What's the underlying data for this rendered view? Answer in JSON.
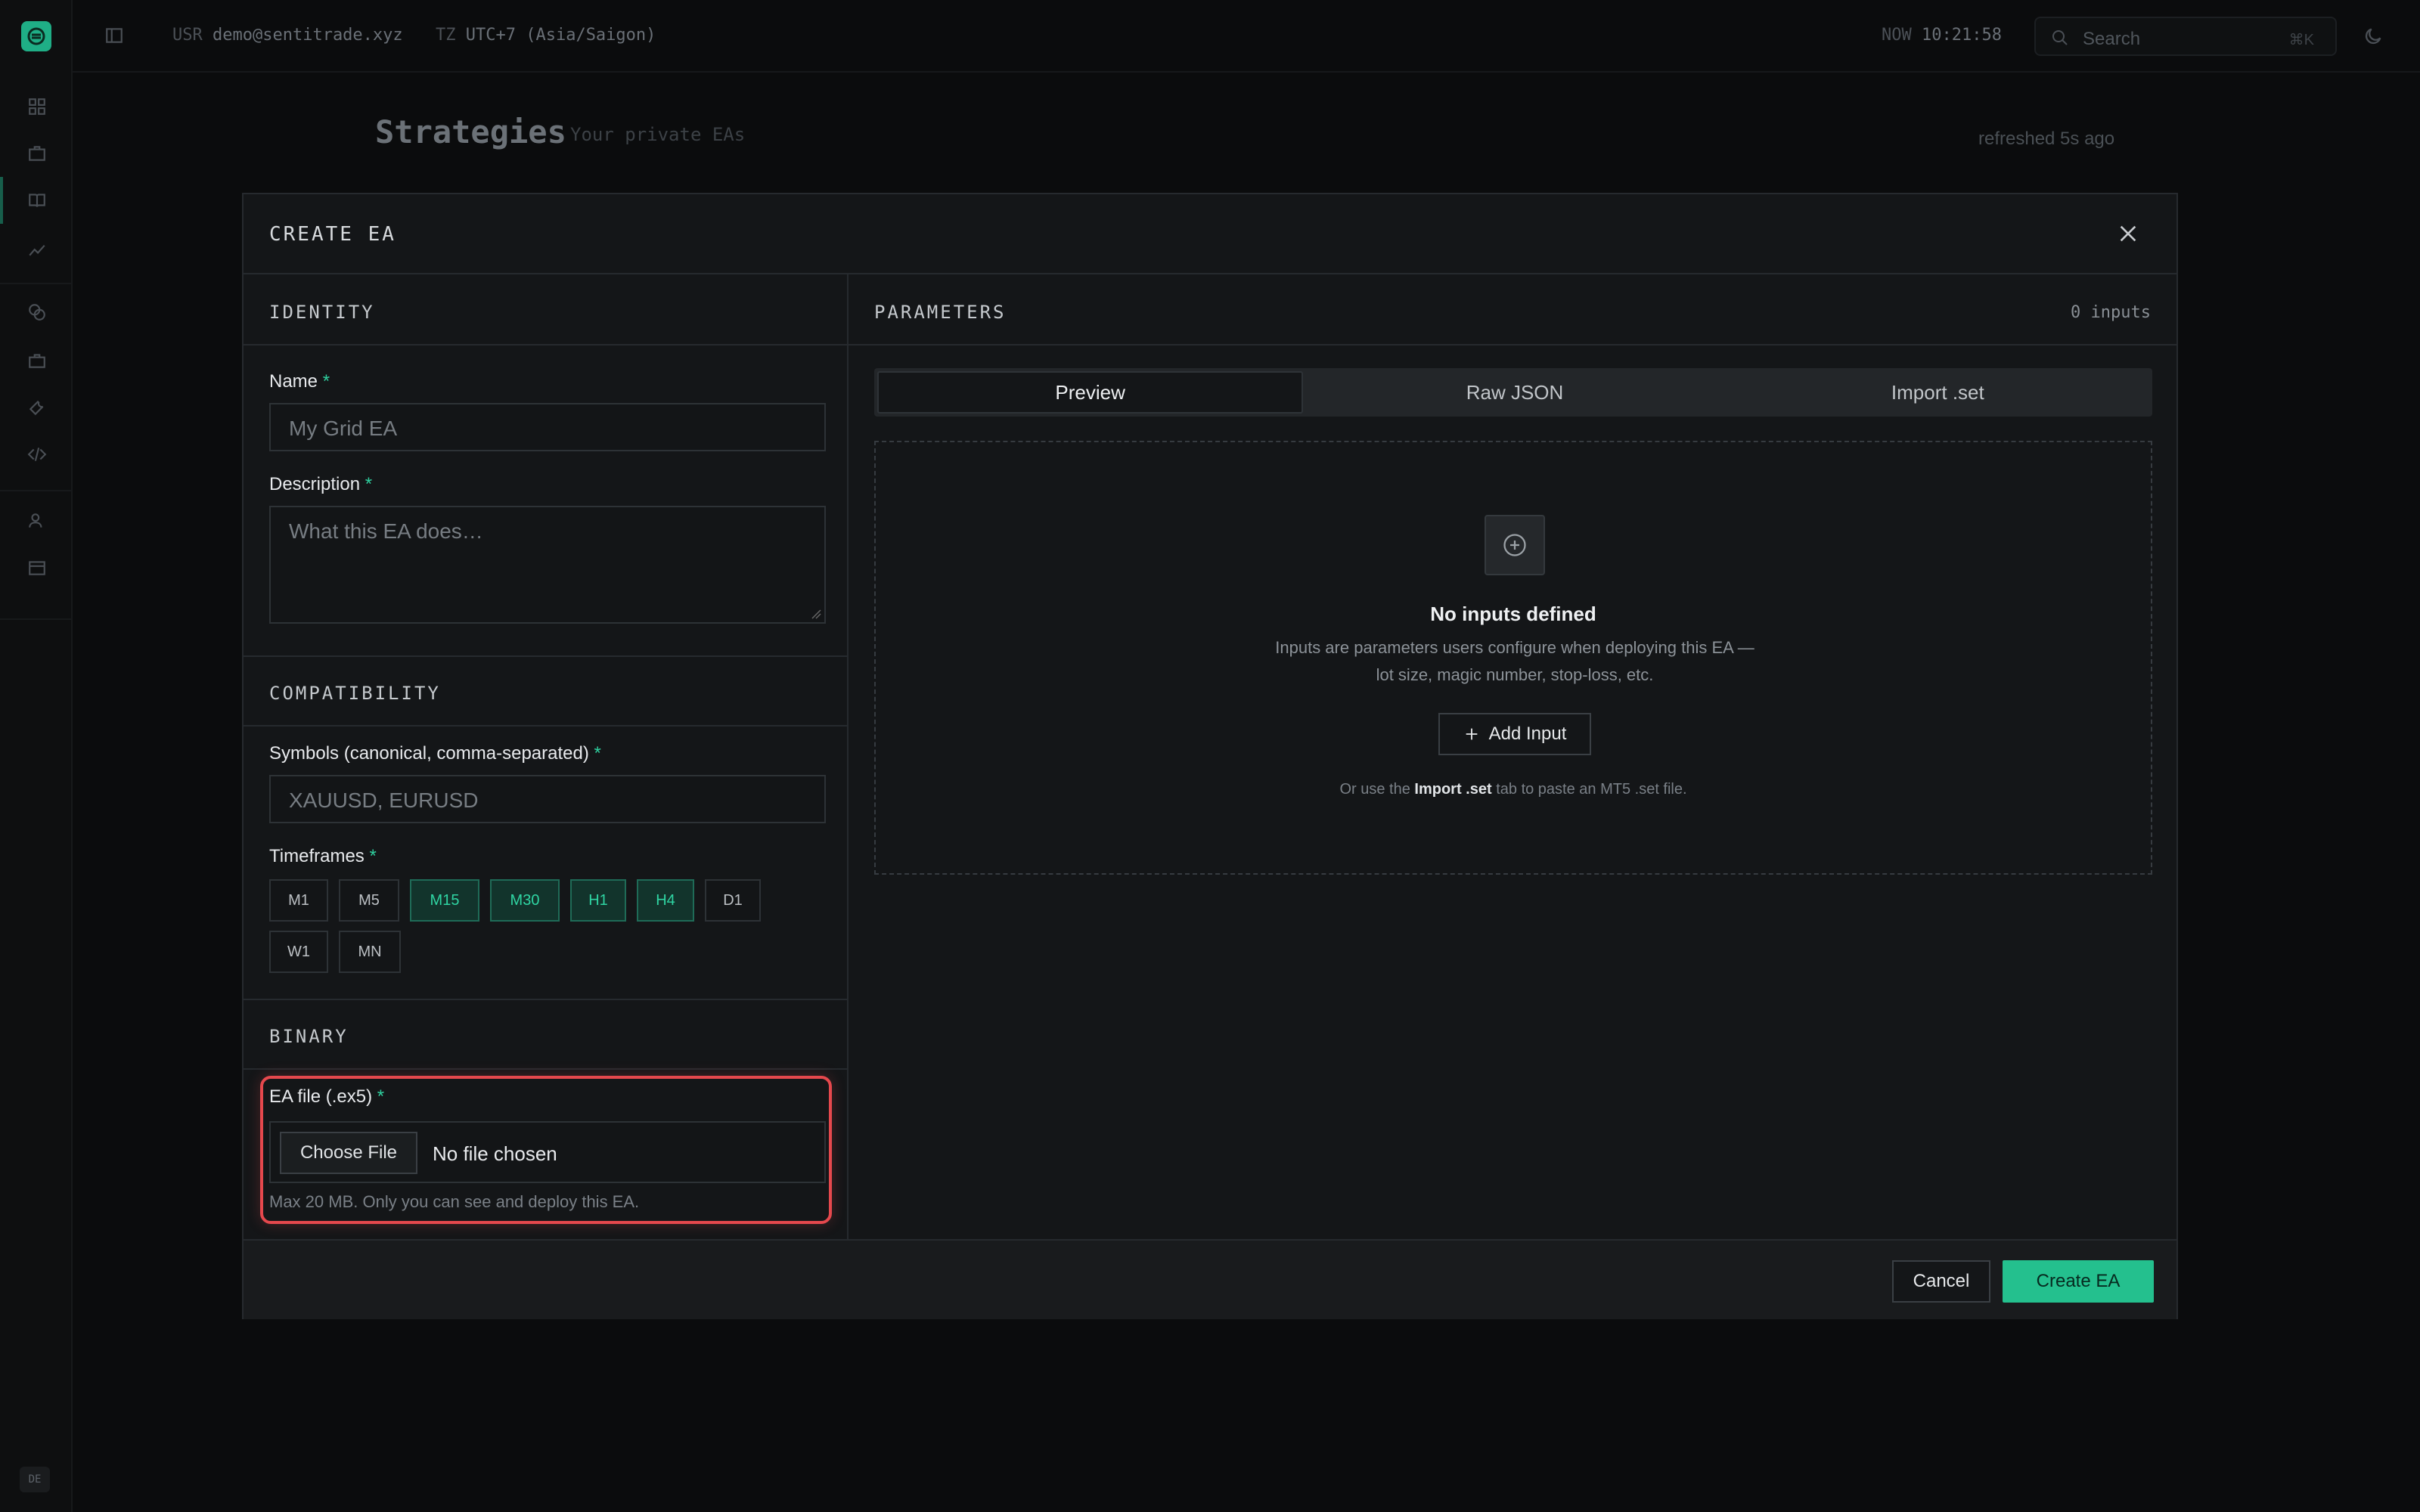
{
  "topbar": {
    "usr_label": "USR",
    "usr_value": "demo@sentitrade.xyz",
    "tz_label": "TZ",
    "tz_value": "UTC+7 (Asia/Saigon)",
    "now_label": "NOW",
    "now_value": "10:21:58",
    "search_label": "Search",
    "search_shortcut": "⌘K"
  },
  "page": {
    "title": "Strategies",
    "subtitle": "Your private EAs",
    "refreshed": "refreshed 5s ago"
  },
  "sidebar": {
    "footer_badge": "DE"
  },
  "modal": {
    "title": "CREATE EA",
    "identity": {
      "heading": "IDENTITY",
      "name_label": "Name",
      "name_placeholder": "My Grid EA",
      "description_label": "Description",
      "description_placeholder": "What this EA does…"
    },
    "compatibility": {
      "heading": "COMPATIBILITY",
      "symbols_label": "Symbols (canonical, comma-separated)",
      "symbols_placeholder": "XAUUSD, EURUSD",
      "timeframes_label": "Timeframes",
      "timeframes": [
        {
          "label": "M1",
          "selected": false
        },
        {
          "label": "M5",
          "selected": false
        },
        {
          "label": "M15",
          "selected": true
        },
        {
          "label": "M30",
          "selected": true
        },
        {
          "label": "H1",
          "selected": true
        },
        {
          "label": "H4",
          "selected": true
        },
        {
          "label": "D1",
          "selected": false
        },
        {
          "label": "W1",
          "selected": false
        },
        {
          "label": "MN",
          "selected": false
        }
      ]
    },
    "binary": {
      "heading": "BINARY",
      "file_label": "EA file (.ex5)",
      "choose_button": "Choose File",
      "file_status": "No file chosen",
      "hint": "Max 20 MB. Only you can see and deploy this EA."
    },
    "required_mark": "*",
    "parameters": {
      "heading": "PARAMETERS",
      "count": "0 inputs",
      "tabs": [
        "Preview",
        "Raw JSON",
        "Import .set"
      ],
      "active_tab": "Preview",
      "empty_title": "No inputs defined",
      "empty_desc": "Inputs are parameters users configure when deploying this EA — lot size, magic number, stop-loss, etc.",
      "add_button": "Add Input",
      "footnote_pre": "Or use the",
      "footnote_bold": "Import .set",
      "footnote_post": "tab to paste an MT5 .set file."
    },
    "footer": {
      "cancel": "Cancel",
      "create": "Create EA"
    }
  },
  "colors": {
    "accent": "#24c08e",
    "highlight_border": "#e5484d",
    "modal_bg": "#141618",
    "page_bg": "#0b0c0d"
  }
}
